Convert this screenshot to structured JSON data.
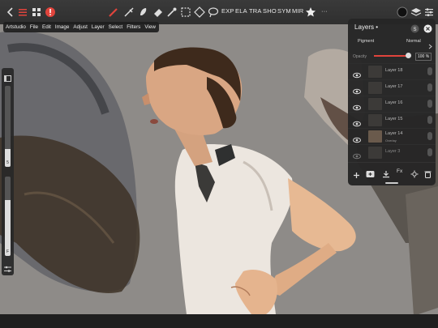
{
  "toolbar": {
    "exp": "EXP",
    "ela": "ELA",
    "tra": "TRA",
    "sho": "SHO",
    "sym": "SYM",
    "mir": "MIR",
    "more": "···"
  },
  "menu": [
    "Artstudio",
    "File",
    "Edit",
    "Image",
    "Adjust",
    "Layer",
    "Select",
    "Filters",
    "View"
  ],
  "left_sliders": {
    "size": {
      "value": "5",
      "fraction": 0.22
    },
    "opacity": {
      "value": "F",
      "fraction": 0.7
    }
  },
  "layers": {
    "title": "Layers •",
    "blend_pigment": "Pigment",
    "blend_mode": "Normal",
    "opacity_label": "Opacity",
    "opacity_value": "100 %",
    "opacity_fraction": 1.0,
    "items": [
      {
        "name": "Layer 18",
        "sub": "",
        "visible": true
      },
      {
        "name": "Layer 17",
        "sub": "",
        "visible": true
      },
      {
        "name": "Layer 16",
        "sub": "",
        "visible": true
      },
      {
        "name": "Layer 15",
        "sub": "",
        "visible": true
      },
      {
        "name": "Layer 14",
        "sub": "Overlay",
        "visible": true
      },
      {
        "name": "Layer 3",
        "sub": "",
        "visible": false
      }
    ]
  },
  "colors": {
    "accent_red": "#e0443c",
    "topbar": "#333333",
    "panel": "#262626",
    "canvas": "#8d8a87"
  }
}
